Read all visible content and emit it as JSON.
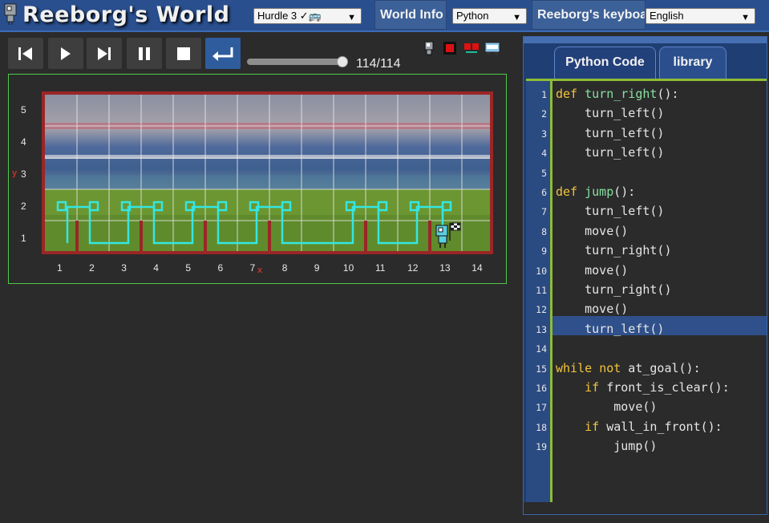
{
  "app": {
    "title": "Reeborg's World"
  },
  "header": {
    "world_select": "Hurdle 3 ✓🚌",
    "world_info_label": "World Info",
    "language_select": "Python",
    "keyboard_label": "Reeborg's keyboard",
    "ui_language_select": "English"
  },
  "toolbar": {
    "buttons": [
      "reload-icon",
      "run-icon",
      "step-icon",
      "pause-icon",
      "stop-icon",
      "return-icon"
    ],
    "step_counter": "114/114",
    "slider_fraction": 1.0
  },
  "world": {
    "rows": [
      "5",
      "4",
      "3",
      "2",
      "1"
    ],
    "cols": [
      "1",
      "2",
      "3",
      "4",
      "5",
      "6",
      "7",
      "8",
      "9",
      "10",
      "11",
      "12",
      "13",
      "14"
    ],
    "x_letter": "x",
    "y_letter": "y",
    "wall_color": "#9a2626",
    "trace_color": "#35e6e0"
  },
  "sidebar": {
    "tabs": [
      "Python Code",
      "library"
    ],
    "highlighted_line": 13,
    "code_lines": [
      {
        "n": "1",
        "text": "def turn_right():"
      },
      {
        "n": "2",
        "text": "    turn_left()"
      },
      {
        "n": "3",
        "text": "    turn_left()"
      },
      {
        "n": "4",
        "text": "    turn_left()"
      },
      {
        "n": "5",
        "text": ""
      },
      {
        "n": "6",
        "text": "def jump():"
      },
      {
        "n": "7",
        "text": "    turn_left()"
      },
      {
        "n": "8",
        "text": "    move()"
      },
      {
        "n": "9",
        "text": "    turn_right()"
      },
      {
        "n": "10",
        "text": "    move()"
      },
      {
        "n": "11",
        "text": "    turn_right()"
      },
      {
        "n": "12",
        "text": "    move()"
      },
      {
        "n": "13",
        "text": "    turn_left()"
      },
      {
        "n": "14",
        "text": ""
      },
      {
        "n": "15",
        "text": "while not at_goal():"
      },
      {
        "n": "16",
        "text": "    if front_is_clear():"
      },
      {
        "n": "17",
        "text": "        move()"
      },
      {
        "n": "18",
        "text": "    if wall_in_front():"
      },
      {
        "n": "19",
        "text": "        jump()"
      }
    ]
  }
}
